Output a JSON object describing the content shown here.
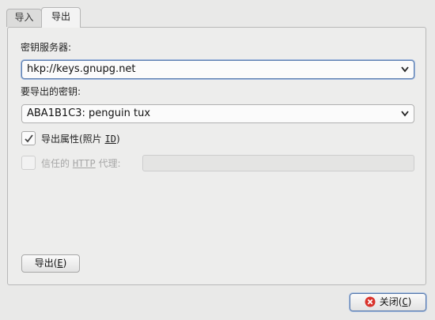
{
  "tabs": [
    {
      "label": "导入",
      "active": false
    },
    {
      "label": "导出",
      "active": true
    }
  ],
  "keyserver": {
    "label": "密钥服务器:",
    "value": "hkp://keys.gnupg.net"
  },
  "key_to_export": {
    "label": "要导出的密钥:",
    "value": "ABA1B1C3: penguin tux"
  },
  "export_attributes": {
    "label_prefix": "导出属性(照片 ",
    "label_mnemonic": "ID",
    "label_suffix": ")",
    "checked": true
  },
  "http_proxy": {
    "label_prefix": "信任的 ",
    "label_mnemonic": "HTTP",
    "label_suffix": " 代理:",
    "checked": false,
    "enabled": false,
    "value": ""
  },
  "export_button": {
    "label_prefix": "导出(",
    "mnemonic": "E",
    "label_suffix": ")"
  },
  "close_button": {
    "label_prefix": "关闭(",
    "mnemonic": "C",
    "label_suffix": ")",
    "icon": "close-icon"
  },
  "colors": {
    "focus_border": "#5c7fb0",
    "close_icon": "#d9322b"
  }
}
